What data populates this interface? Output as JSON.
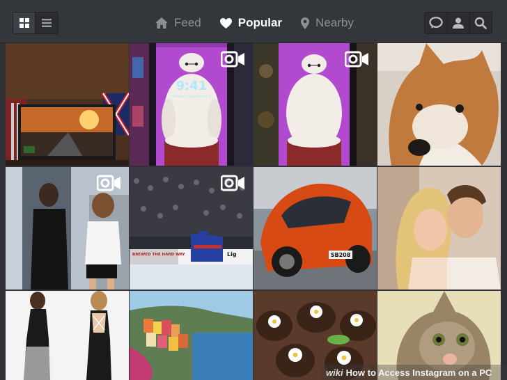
{
  "nav": {
    "items": [
      {
        "label": "Feed",
        "icon": "home-icon",
        "active": false
      },
      {
        "label": "Popular",
        "icon": "heart-icon",
        "active": true
      },
      {
        "label": "Nearby",
        "icon": "location-pin-icon",
        "active": false
      }
    ]
  },
  "view_toggle": {
    "grid_icon": "grid-view-icon",
    "list_icon": "list-view-icon",
    "active": "grid"
  },
  "actions": {
    "icons": [
      "chat-bubble-icon",
      "user-profile-icon",
      "search-icon"
    ]
  },
  "phone_screen": {
    "time": "9:41",
    "date": "Tuesday, September 9"
  },
  "car_plate": "SB208",
  "hockey_boards": {
    "left": "BREWED THE HARD WAY",
    "right": "Lig"
  },
  "watermark": {
    "brand": "wiki",
    "text": "How to Access Instagram on a PC"
  },
  "colors": {
    "accent_white": "#ffffff",
    "inactive": "#8b9096",
    "bar": "#33363b"
  }
}
